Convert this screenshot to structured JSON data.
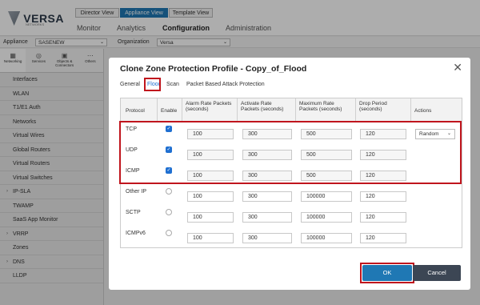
{
  "app": {
    "logo_text": "VERSA",
    "logo_subtext": "NETWORKS",
    "view_tabs": [
      "Director View",
      "Appliance View",
      "Template View"
    ],
    "nav_tabs": [
      "Monitor",
      "Analytics",
      "Configuration",
      "Administration"
    ]
  },
  "context_bar": {
    "appliance_label": "Appliance",
    "appliance_value": "SASENEW",
    "organization_label": "Organization",
    "organization_value": "Versa"
  },
  "sidebar": {
    "icon_tabs": [
      {
        "label": "Networking",
        "glyph": "▦"
      },
      {
        "label": "Services",
        "glyph": "◎"
      },
      {
        "label": "Objects & Connectors",
        "glyph": "▣"
      },
      {
        "label": "Others",
        "glyph": "⋯"
      }
    ],
    "items": [
      {
        "label": "Interfaces",
        "caret": ""
      },
      {
        "label": "WLAN",
        "caret": ""
      },
      {
        "label": "T1/E1 Auth",
        "caret": ""
      },
      {
        "label": "Networks",
        "caret": ""
      },
      {
        "label": "Virtual Wires",
        "caret": ""
      },
      {
        "label": "Global Routers",
        "caret": ""
      },
      {
        "label": "Virtual Routers",
        "caret": ""
      },
      {
        "label": "Virtual Switches",
        "caret": ""
      },
      {
        "label": "IP-SLA",
        "caret": "›"
      },
      {
        "label": "TWAMP",
        "caret": ""
      },
      {
        "label": "SaaS App Monitor",
        "caret": ""
      },
      {
        "label": "VRRP",
        "caret": "›"
      },
      {
        "label": "Zones",
        "caret": ""
      },
      {
        "label": "DNS",
        "caret": "›"
      },
      {
        "label": "LLDP",
        "caret": ""
      }
    ]
  },
  "dialog": {
    "title": "Clone Zone Protection Profile - Copy_of_Flood",
    "close_glyph": "✕",
    "tabs": [
      "General",
      "Flood",
      "Scan",
      "Packet Based Attack Protection"
    ],
    "active_tab": "Flood",
    "columns": [
      "Protocol",
      "Enable",
      "Alarm Rate Packets (seconds)",
      "Activate Rate Packets (seconds)",
      "Maximum Rate Packets (seconds)",
      "Drop Period (seconds)",
      "Actions"
    ],
    "rows": [
      {
        "protocol": "TCP",
        "enabled": true,
        "alarm": "100",
        "activate": "300",
        "maximum": "500",
        "drop": "120",
        "action": "Random"
      },
      {
        "protocol": "UDP",
        "enabled": true,
        "alarm": "100",
        "activate": "300",
        "maximum": "500",
        "drop": "120",
        "action": ""
      },
      {
        "protocol": "ICMP",
        "enabled": true,
        "alarm": "100",
        "activate": "300",
        "maximum": "500",
        "drop": "120",
        "action": ""
      },
      {
        "protocol": "Other IP",
        "enabled": false,
        "alarm": "100",
        "activate": "300",
        "maximum": "100000",
        "drop": "120",
        "action": ""
      },
      {
        "protocol": "SCTP",
        "enabled": false,
        "alarm": "100",
        "activate": "300",
        "maximum": "100000",
        "drop": "120",
        "action": ""
      },
      {
        "protocol": "ICMPv6",
        "enabled": false,
        "alarm": "100",
        "activate": "300",
        "maximum": "100000",
        "drop": "120",
        "action": ""
      }
    ],
    "ok_label": "OK",
    "cancel_label": "Cancel",
    "check_glyph": "✓",
    "chevron_glyph": "⌄"
  },
  "colors": {
    "accent": "#1f78b4",
    "highlight": "#c0151d",
    "cancel": "#3c4654"
  }
}
